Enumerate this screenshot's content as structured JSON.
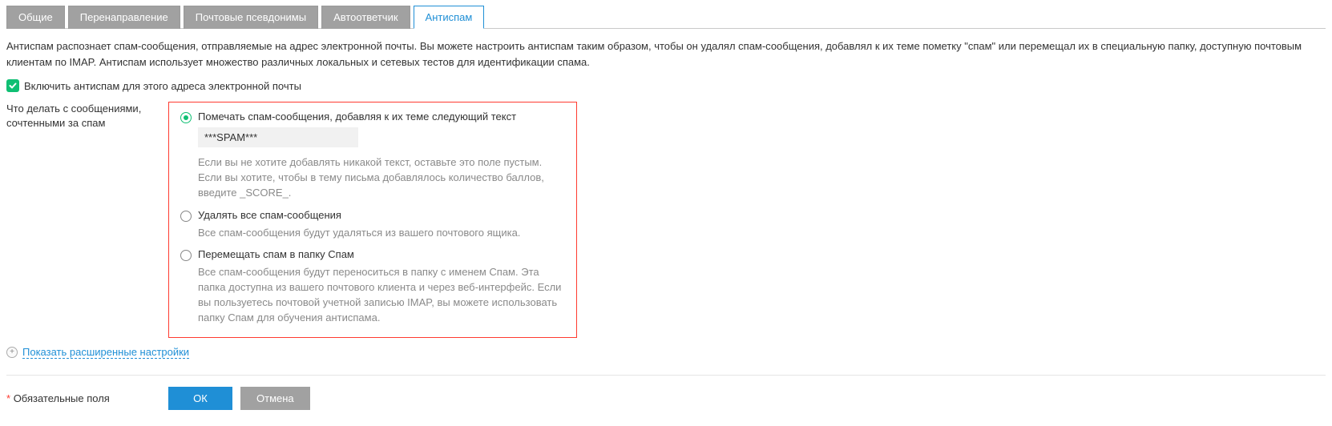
{
  "tabs": {
    "general": "Общие",
    "forwarding": "Перенаправление",
    "aliases": "Почтовые псевдонимы",
    "autoresponder": "Автоответчик",
    "antispam": "Антиспам"
  },
  "intro": "Антиспам распознает спам-сообщения, отправляемые на адрес электронной почты. Вы можете настроить антиспам таким образом, чтобы он удалял спам-сообщения, добавлял к их теме пометку \"спам\" или перемещал их в специальную папку, доступную почтовым клиентам по IMAP. Антиспам использует множество различных локальных и сетевых тестов для идентификации спама.",
  "enable_label": "Включить антиспам для этого адреса электронной почты",
  "action_section": {
    "label": "Что делать с сообщениями, сочтенными за спам",
    "opt_mark": {
      "title": "Помечать спам-сообщения, добавляя к их теме следующий текст",
      "input_value": "***SPAM***",
      "desc": "Если вы не хотите добавлять никакой текст, оставьте это поле пустым. Если вы хотите, чтобы в тему письма добавлялось количество баллов, введите _SCORE_."
    },
    "opt_delete": {
      "title": "Удалять все спам-сообщения",
      "desc": "Все спам-сообщения будут удаляться из вашего почтового ящика."
    },
    "opt_move": {
      "title": "Перемещать спам в папку Спам",
      "desc": "Все спам-сообщения будут переноситься в папку с именем Спам. Эта папка доступна из вашего почтового клиента и через веб-интерфейс. Если вы пользуетесь почтовой учетной записью IMAP, вы можете использовать папку Спам для обучения антиспама."
    }
  },
  "advanced_link": "Показать расширенные настройки",
  "required_label": "Обязательные поля",
  "buttons": {
    "ok": "ОК",
    "cancel": "Отмена"
  }
}
